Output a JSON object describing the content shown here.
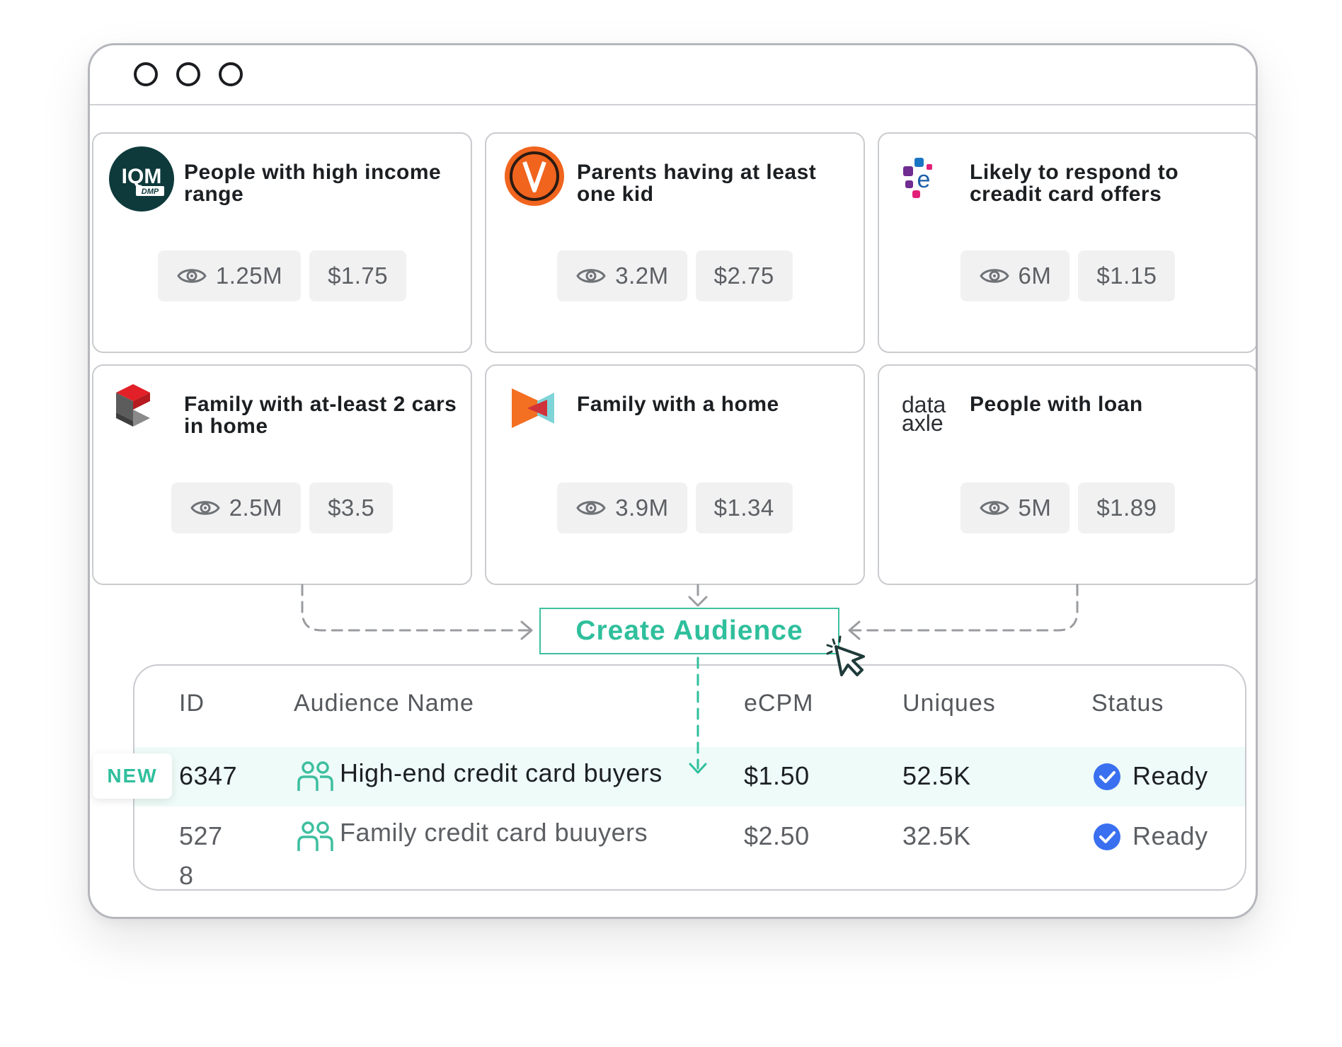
{
  "window": {
    "controls": [
      "window-control-1",
      "window-control-2",
      "window-control-3"
    ]
  },
  "segments": [
    {
      "logo": "iqm-dmp-logo",
      "logo_text": "IQM",
      "logo_subtext": "DMP",
      "title": "People with high income range",
      "uniques": "1.25M",
      "price": "$1.75"
    },
    {
      "logo": "v-circle-logo",
      "title": "Parents having at least one kid",
      "uniques": "3.2M",
      "price": "$2.75"
    },
    {
      "logo": "experian-dots-logo",
      "logo_text": "e",
      "title": "Likely to respond to creadit card offers",
      "uniques": "6M",
      "price": "$1.15"
    },
    {
      "logo": "red-gray-cube-logo",
      "title": "Family with at-least 2 cars in home",
      "uniques": "2.5M",
      "price": "$3.5"
    },
    {
      "logo": "orange-play-logo",
      "title": "Family with a home",
      "uniques": "3.9M",
      "price": "$1.34"
    },
    {
      "logo": "data-axle-logo",
      "logo_text": "data",
      "logo_subtext": "axle",
      "title": "People with loan",
      "uniques": "5M",
      "price": "$1.89"
    }
  ],
  "create_button": {
    "label": "Create Audience"
  },
  "table": {
    "headers": {
      "id": "ID",
      "name": "Audience Name",
      "ecpm": "eCPM",
      "uniques": "Uniques",
      "status": "Status"
    },
    "rows": [
      {
        "badge": "NEW",
        "id": "6347",
        "name": "High-end credit card buyers",
        "ecpm": "$1.50",
        "uniques": "52.5K",
        "status": "Ready"
      },
      {
        "id_line1": "527",
        "id_line2": "8",
        "name": "Family credit card buuyers",
        "ecpm": "$2.50",
        "uniques": "32.5K",
        "status": "Ready"
      }
    ]
  },
  "colors": {
    "accent_green": "#2fbf9c",
    "check_blue": "#3a6ff0",
    "highlight_row": "#eefbf8",
    "border_gray": "#c9cbcf"
  }
}
